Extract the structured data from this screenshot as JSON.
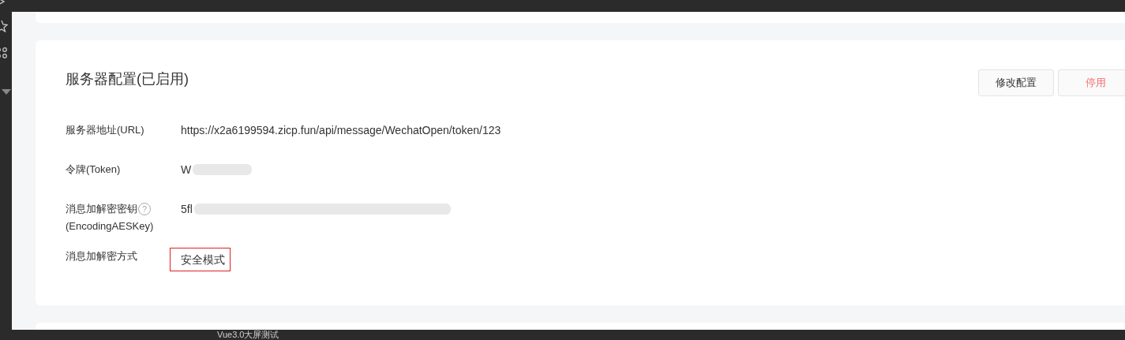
{
  "background": {
    "bottom_text": "Vue3.0大屏测试"
  },
  "card": {
    "title": "服务器配置(已启用)",
    "buttons": [
      {
        "label": "修改配置",
        "kind": "default"
      },
      {
        "label": "停用",
        "kind": "danger"
      }
    ],
    "fields": [
      {
        "label": "服务器地址(URL)",
        "value": "https://x2a6199594.zicp.fun/api/message/WechatOpen/token/123",
        "kind": "text"
      },
      {
        "label": "令牌(Token)",
        "value": "W",
        "kind": "redacted"
      },
      {
        "label": "消息加解密密钥",
        "help_icon": "?",
        "label_line_2": "(EncodingAESKey)",
        "value": "5fl",
        "kind": "redacted"
      },
      {
        "label": "消息加解密方式",
        "value": "安全模式",
        "kind": "highlighted"
      }
    ]
  }
}
